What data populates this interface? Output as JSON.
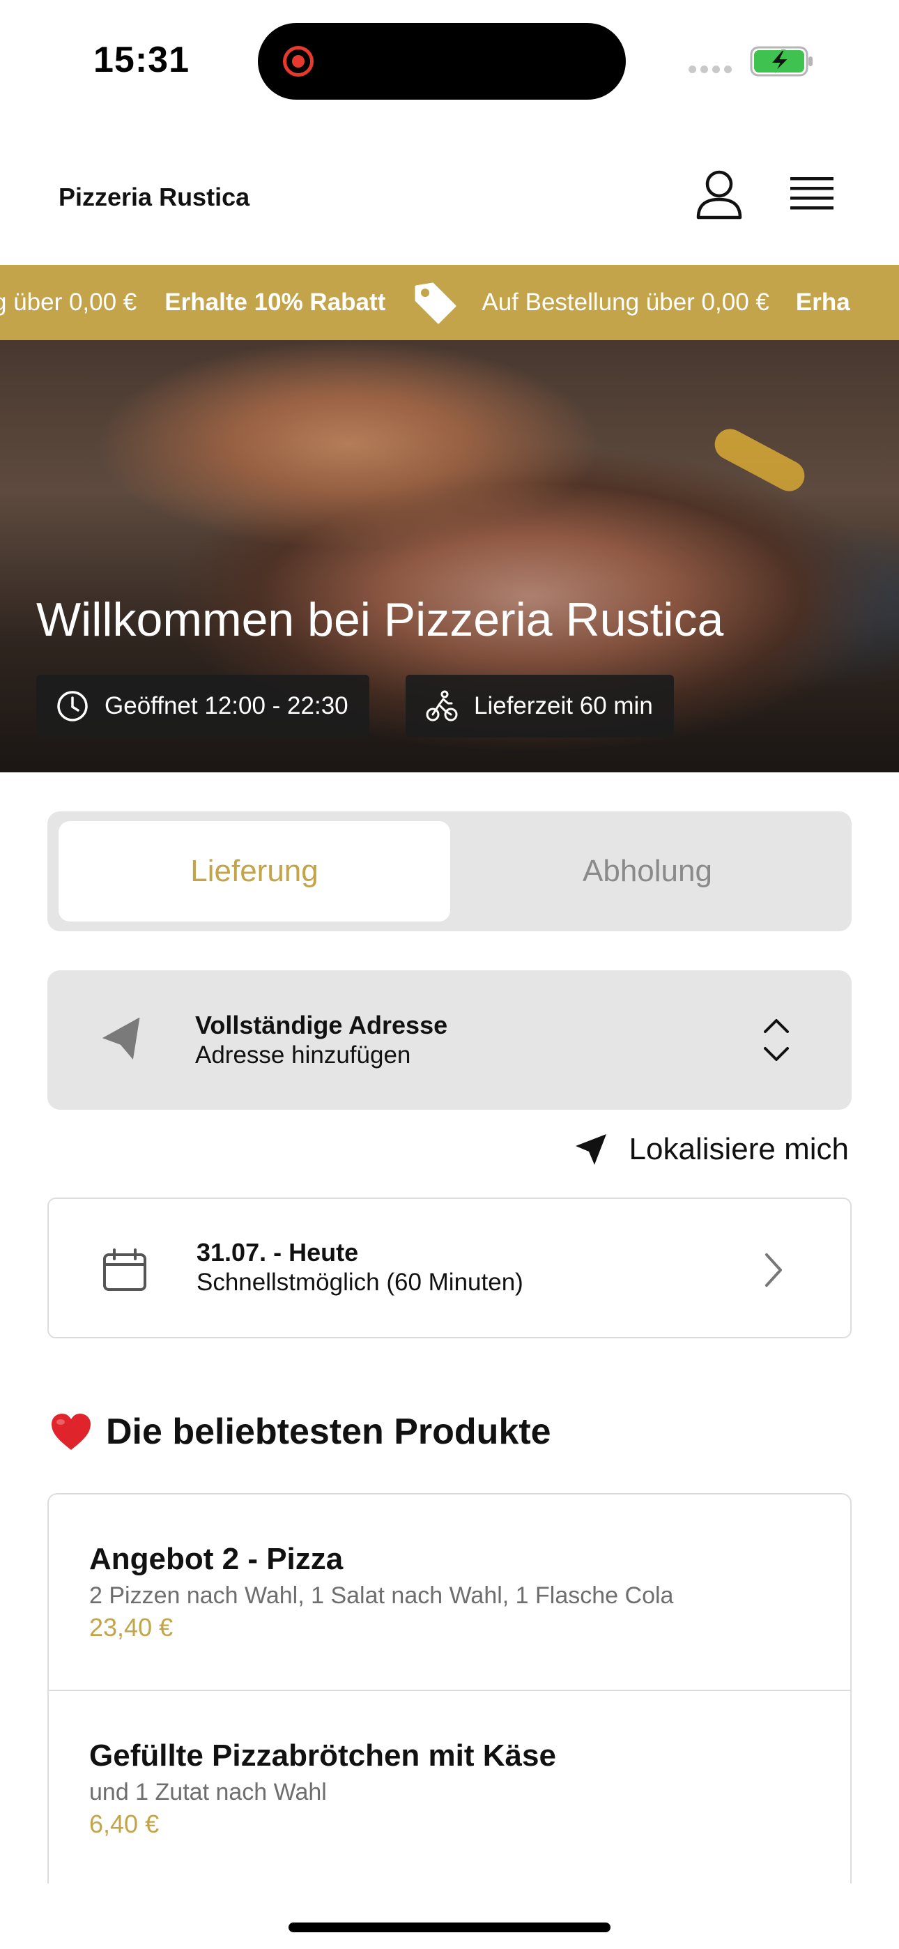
{
  "status_bar": {
    "time": "15:31"
  },
  "header": {
    "brand": "Pizzeria Rustica"
  },
  "ticker": {
    "text_a": "g über 0,00 €",
    "text_b": "Erhalte 10% Rabatt",
    "text_c": "Auf Bestellung über 0,00 €",
    "text_d": "Erha"
  },
  "hero": {
    "title": "Willkommen bei Pizzeria Rustica",
    "hours": "Geöffnet 12:00 - 22:30",
    "delivery_time": "Lieferzeit 60 min"
  },
  "order_mode": {
    "tabs": [
      "Lieferung",
      "Abholung"
    ],
    "selected": "Lieferung"
  },
  "address": {
    "label": "Vollständige Adresse",
    "placeholder": "Adresse hinzufügen",
    "locate": "Lokalisiere mich"
  },
  "schedule": {
    "date": "31.07. - Heute",
    "time": "Schnellstmöglich (60 Minuten)"
  },
  "popular": {
    "title": "Die beliebtesten Produkte",
    "products": [
      {
        "name": "Angebot 2 - Pizza",
        "description": "2 Pizzen nach Wahl, 1 Salat nach Wahl, 1 Flasche Cola",
        "price": "23,40 €"
      },
      {
        "name": "Gefüllte Pizzabrötchen mit Käse",
        "description": "und 1 Zutat nach Wahl",
        "price": "6,40 €"
      }
    ]
  },
  "colors": {
    "accent": "#c3a44a",
    "panel": "#e5e5e5",
    "chip": "#1c1c1c"
  }
}
